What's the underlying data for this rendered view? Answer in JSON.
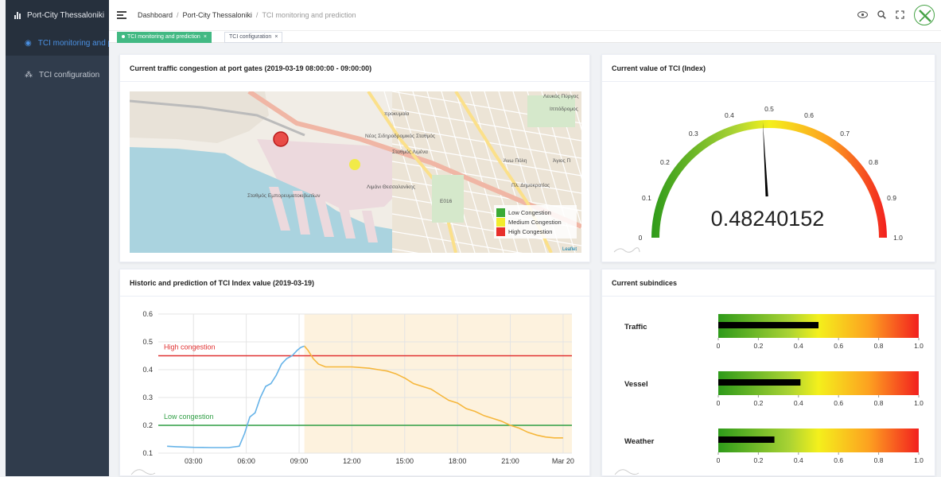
{
  "app": {
    "title": "Port-City Thessaloniki"
  },
  "sidebar": {
    "items": [
      {
        "label": "TCI monitoring and prediction",
        "icon": "dashboard-icon"
      },
      {
        "label": "TCI configuration",
        "icon": "sitemap-icon"
      }
    ]
  },
  "breadcrumb": {
    "items": [
      "Dashboard",
      "Port-City Thessaloniki",
      "TCI monitoring and prediction"
    ]
  },
  "tags": [
    {
      "label": "TCI monitoring and prediction"
    },
    {
      "label": "TCI configuration"
    }
  ],
  "map_card": {
    "title": "Current traffic congestion at port gates (2019-03-19 08:00:00 - 09:00:00)",
    "legend": [
      {
        "label": "Low Congestion",
        "color": "#3aaa35"
      },
      {
        "label": "Medium Congestion",
        "color": "#f2ec2e"
      },
      {
        "label": "High Congestion",
        "color": "#e8302c"
      }
    ],
    "attribution": "Leaflet",
    "labels": [
      "Νέος Σιδηροδρομικός Σταθμός",
      "Άνω Πόλη",
      "Άγιος Π",
      "Λιμάνι Θεσσαλονίκης",
      "Σταθμός Εμπορευματοκιβωτίων",
      "E016",
      "προκυμαία",
      "Λευκός Πύργος",
      "Ιππόδρομος",
      "Σταθμός Λιμένα",
      "Πλ. Δημοκρατίας"
    ]
  },
  "gauge_card": {
    "title": "Current value of TCI (Index)",
    "value": "0.48240152",
    "value_num": 0.48240152,
    "ticks": [
      "0",
      "0.1",
      "0.2",
      "0.3",
      "0.4",
      "0.5",
      "0.6",
      "0.7",
      "0.8",
      "0.9",
      "1.0"
    ]
  },
  "history_card": {
    "title": "Historic and prediction of TCI Index value (2019-03-19)"
  },
  "chart_data": {
    "type": "line",
    "ylim": [
      0.1,
      0.6
    ],
    "yticks": [
      "0.6",
      "0.5",
      "0.4",
      "0.3",
      "0.2",
      "0.1"
    ],
    "xticks": [
      "03:00",
      "06:00",
      "09:00",
      "12:00",
      "15:00",
      "18:00",
      "21:00",
      "Mar 20"
    ],
    "threshold_lines": [
      {
        "label": "High congestion",
        "value": 0.45,
        "color": "#e03131"
      },
      {
        "label": "Low congestion",
        "value": 0.2,
        "color": "#2f9e44"
      }
    ],
    "series": [
      {
        "color": "#66b3e8",
        "x": [
          1.5,
          2,
          3,
          4,
          5,
          5.6,
          5.9,
          6.2,
          6.5,
          6.8,
          7.1,
          7.4,
          7.7,
          8,
          8.3,
          8.6,
          8.9,
          9.1,
          9.3
        ],
        "values": [
          0.125,
          0.123,
          0.121,
          0.12,
          0.12,
          0.125,
          0.17,
          0.23,
          0.245,
          0.3,
          0.34,
          0.35,
          0.38,
          0.42,
          0.44,
          0.45,
          0.47,
          0.48,
          0.485
        ]
      },
      {
        "color": "#f6b73c",
        "x": [
          9.3,
          9.5,
          9.8,
          10.1,
          10.5,
          11,
          12,
          13,
          13.5,
          14,
          14.5,
          15,
          15.5,
          16,
          16.5,
          17,
          17.5,
          18,
          18.5,
          19,
          19.5,
          20,
          20.5,
          21,
          21.5,
          22,
          22.5,
          23,
          23.5,
          24
        ],
        "values": [
          0.485,
          0.47,
          0.44,
          0.42,
          0.41,
          0.41,
          0.41,
          0.405,
          0.4,
          0.395,
          0.385,
          0.37,
          0.35,
          0.34,
          0.33,
          0.31,
          0.29,
          0.28,
          0.26,
          0.25,
          0.235,
          0.225,
          0.215,
          0.2,
          0.19,
          0.175,
          0.165,
          0.158,
          0.155,
          0.155
        ]
      }
    ],
    "prediction_region": {
      "from": 9.3,
      "to": 24,
      "color": "#fdf2de"
    }
  },
  "subindices_card": {
    "title": "Current subindices",
    "items": [
      {
        "label": "Traffic",
        "value": 0.5
      },
      {
        "label": "Vessel",
        "value": 0.41
      },
      {
        "label": "Weather",
        "value": 0.28
      }
    ],
    "ticks": [
      "0",
      "0.2",
      "0.4",
      "0.6",
      "0.8",
      "1.0"
    ]
  }
}
